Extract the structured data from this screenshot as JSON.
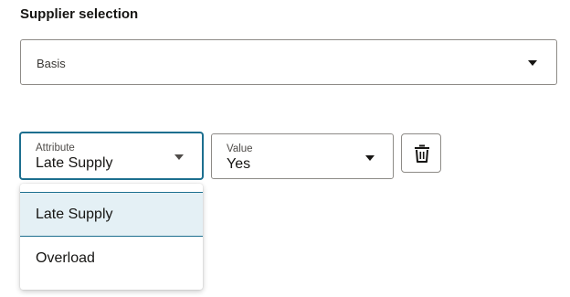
{
  "section": {
    "title": "Supplier selection"
  },
  "basis_select": {
    "value": "Basis",
    "icon": "chevron-down-icon"
  },
  "attribute_field": {
    "label": "Attribute",
    "value": "Late Supply",
    "icon": "chevron-down-icon",
    "state": "focused",
    "accent_color": "#1d6f8f"
  },
  "value_field": {
    "label": "Value",
    "value": "Yes",
    "icon": "chevron-down-icon"
  },
  "delete_button": {
    "icon": "trash-icon"
  },
  "attribute_dropdown": {
    "options": [
      {
        "label": "Late Supply",
        "selected": true
      },
      {
        "label": "Overload",
        "selected": false
      }
    ],
    "highlight_color": "#e4f0f5"
  }
}
